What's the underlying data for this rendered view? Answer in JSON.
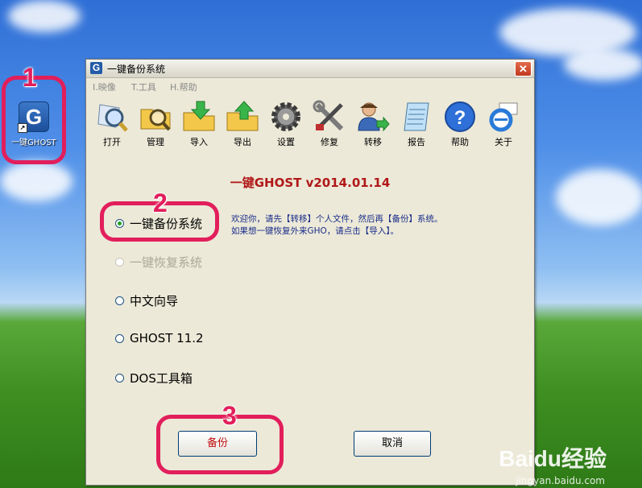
{
  "desktop": {
    "icon_label": "一键GHOST",
    "annotations": [
      "1",
      "2",
      "3"
    ],
    "watermark": "Baidu经验",
    "watermark_url": "jingyan.baidu.com"
  },
  "window": {
    "title": "一键备份系统",
    "close_glyph": "✕",
    "menu": [
      "I.映像",
      "T.工具",
      "H.帮助"
    ],
    "toolbar": [
      {
        "label": "打开",
        "icon": "open-magnifier-icon"
      },
      {
        "label": "管理",
        "icon": "manage-folder-icon"
      },
      {
        "label": "导入",
        "icon": "import-folder-icon"
      },
      {
        "label": "导出",
        "icon": "export-folder-icon"
      },
      {
        "label": "设置",
        "icon": "settings-gear-icon"
      },
      {
        "label": "修复",
        "icon": "repair-tools-icon"
      },
      {
        "label": "转移",
        "icon": "transfer-user-icon"
      },
      {
        "label": "报告",
        "icon": "report-notepad-icon"
      },
      {
        "label": "帮助",
        "icon": "help-icon"
      },
      {
        "label": "关于",
        "icon": "about-ie-icon"
      }
    ],
    "heading": "一键GHOST v2014.01.14",
    "options": [
      {
        "label": "一键备份系统",
        "selected": true,
        "enabled": true
      },
      {
        "label": "一键恢复系统",
        "selected": false,
        "enabled": false
      },
      {
        "label": "中文向导",
        "selected": false,
        "enabled": true
      },
      {
        "label": "GHOST 11.2",
        "selected": false,
        "enabled": true
      },
      {
        "label": "DOS工具箱",
        "selected": false,
        "enabled": true
      }
    ],
    "info_lines": [
      "欢迎你，请先【转移】个人文件，然后再【备份】系统。",
      "如果想一键恢复外来GHO，请点击【导入】。"
    ],
    "buttons": {
      "primary": "备份",
      "cancel": "取消"
    },
    "colors": {
      "heading": "#b01818",
      "primary_button_text": "#c01010",
      "annotation": "#e21e5b"
    }
  }
}
